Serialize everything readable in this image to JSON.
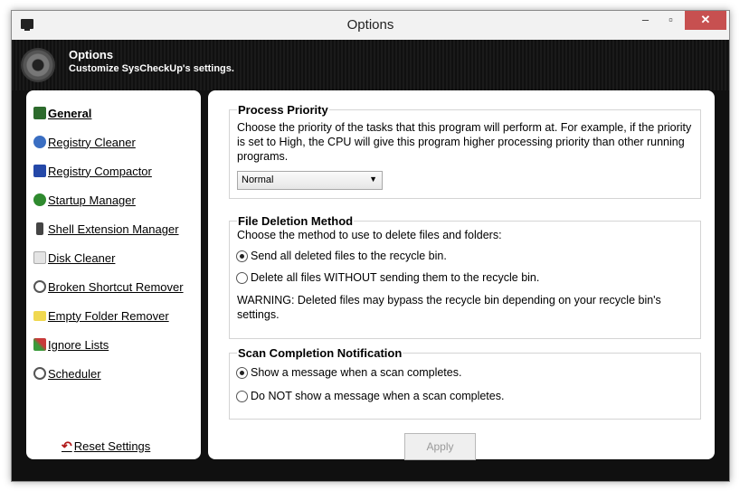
{
  "window": {
    "title": "Options",
    "minimize": "–",
    "maximize": "▫",
    "close": "✕"
  },
  "header": {
    "title": "Options",
    "subtitle": "Customize SysCheckUp's settings."
  },
  "sidebar": {
    "items": [
      {
        "label": "General",
        "icon": "monitor-icon",
        "color": "#2d6b2d"
      },
      {
        "label": "Registry Cleaner",
        "icon": "registry-icon",
        "color": "#3a6ec2"
      },
      {
        "label": "Registry Compactor",
        "icon": "cube-icon",
        "color": "#2448a8"
      },
      {
        "label": "Startup Manager",
        "icon": "startup-icon",
        "color": "#2f8a2f"
      },
      {
        "label": "Shell Extension Manager",
        "icon": "plug-icon",
        "color": "#444444"
      },
      {
        "label": "Disk Cleaner",
        "icon": "disk-icon",
        "color": "#d0d0d0"
      },
      {
        "label": "Broken Shortcut Remover",
        "icon": "shortcut-icon",
        "color": "#555555"
      },
      {
        "label": "Empty Folder Remover",
        "icon": "folder-icon",
        "color": "#f0d850"
      },
      {
        "label": "Ignore Lists",
        "icon": "ignore-icon",
        "color": "#c83a3a"
      },
      {
        "label": "Scheduler",
        "icon": "clock-icon",
        "color": "#555555"
      }
    ],
    "reset": "Reset Settings"
  },
  "priority": {
    "legend": "Process Priority",
    "description": "Choose the priority of the tasks that this program will perform at. For example, if the priority is set to High, the CPU will give this program higher processing priority than other running programs.",
    "selected": "Normal"
  },
  "deletion": {
    "legend": "File Deletion Method",
    "description": "Choose the method to use to delete files and folders:",
    "option1": "Send all deleted files to the recycle bin.",
    "option2": "Delete all files WITHOUT sending them to the recycle bin.",
    "warning": "WARNING: Deleted files may bypass the recycle bin depending on your recycle bin's settings."
  },
  "notification": {
    "legend": "Scan Completion Notification",
    "option1": "Show a message when a scan completes.",
    "option2": "Do NOT show a message when a scan completes."
  },
  "apply": "Apply"
}
